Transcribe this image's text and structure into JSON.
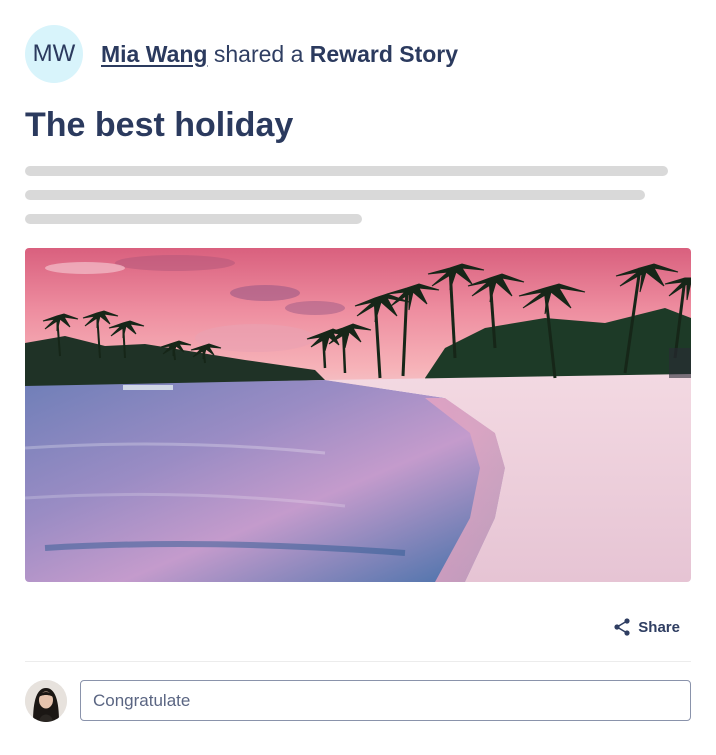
{
  "post": {
    "author_initials": "MW",
    "author_name": "Mia Wang",
    "shared_text": " shared a ",
    "story_type": "Reward Story",
    "title": "The best holiday"
  },
  "actions": {
    "share_label": "Share",
    "share_icon": "share-icon"
  },
  "comment": {
    "placeholder": "Congratulate",
    "value": ""
  },
  "colors": {
    "heading": "#2b3a5e",
    "avatar_bg": "#d8f4fb",
    "skeleton": "#d9d9d9",
    "input_border": "#8a93ab"
  }
}
